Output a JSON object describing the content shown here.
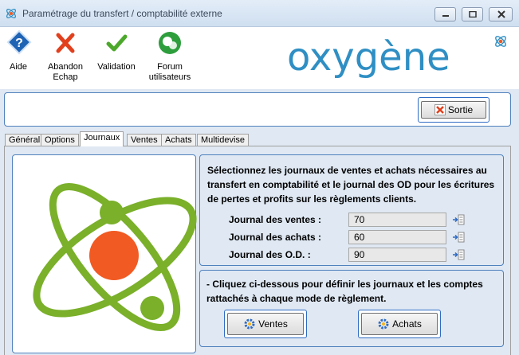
{
  "window": {
    "title": "Paramétrage du transfert / comptabilité externe"
  },
  "toolbar": {
    "help_label": "Aide",
    "abandon_line1": "Abandon",
    "abandon_line2": "Echap",
    "validation_label": "Validation",
    "forum_line1": "Forum",
    "forum_line2": "utilisateurs"
  },
  "brand": {
    "logo_text": "oxygène",
    "color": "#2f8fc4"
  },
  "actions": {
    "sortie_label": "Sortie"
  },
  "tabs": [
    "Général",
    "Options",
    "Journaux",
    "Ventes",
    "Achats",
    "Multidevise"
  ],
  "active_tab": "Journaux",
  "journaux": {
    "intro": "Sélectionnez les journaux de ventes et achats nécessaires au transfert en comptabilité et le journal des OD pour les écritures de pertes et profits sur les règlements clients.",
    "rows": [
      {
        "label": "Journal des ventes :",
        "value": "70"
      },
      {
        "label": "Journal des achats :",
        "value": "60"
      },
      {
        "label": "Journal des O.D.  :",
        "value": "90"
      }
    ],
    "mode_text": "- Cliquez ci-dessous pour définir les journaux et les comptes rattachés à chaque mode de règlement.",
    "ventes_button": "Ventes",
    "achats_button": "Achats"
  },
  "colors": {
    "atom_green": "#7ab02a",
    "atom_core": "#f15a22",
    "panel_border": "#4f81bd"
  },
  "icons": [
    "app-atom-icon",
    "help-icon",
    "abandon-icon",
    "validation-icon",
    "forum-icon",
    "close-icon",
    "picker-icon",
    "gear-icon",
    "atom-illustration"
  ]
}
